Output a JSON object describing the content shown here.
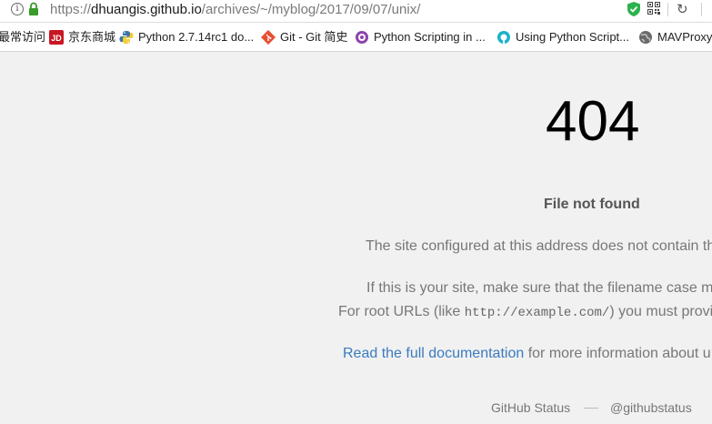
{
  "browser": {
    "url": {
      "scheme": "https://",
      "host": "dhuangis.github.io",
      "path": "/archives/~/myblog/2017/09/07/unix/"
    },
    "info_glyph": "i",
    "reload_glyph": "↻",
    "icons": {
      "info": "info-icon",
      "lock": "lock-icon",
      "shield": "shield-check-icon",
      "qr": "qr-code-icon",
      "reload": "reload-icon"
    },
    "colors": {
      "lock": "#3a9a2a",
      "shield": "#2bb24c"
    }
  },
  "bookmarks": [
    {
      "label": "最常访问",
      "icon": "none"
    },
    {
      "label": "京东商城",
      "icon": "jd-logo-icon",
      "icon_text": "JD",
      "color": "#c81623"
    },
    {
      "label": "Python 2.7.14rc1 do...",
      "icon": "python-logo-icon"
    },
    {
      "label": "Git - Git 简史",
      "icon": "git-logo-icon",
      "color": "#e84e31"
    },
    {
      "label": "Python Scripting in ...",
      "icon": "purple-gear-icon",
      "color": "#8e44ad"
    },
    {
      "label": "Using Python Script...",
      "icon": "teal-drone-icon",
      "color": "#1ab3c8"
    },
    {
      "label": "MAVProxy",
      "icon": "globe-icon",
      "color": "#555555"
    }
  ],
  "page": {
    "code": "404",
    "subtitle": "File not found",
    "line1": "The site configured at this address does not contain th",
    "line2": "If this is your site, make sure that the filename case m",
    "line3_pre": "For root URLs (like ",
    "line3_code": "http://example.com/",
    "line3_post": ") you must provid",
    "link_text": "Read the full documentation",
    "link_post": " for more information about u",
    "link_color": "#3b7bbf"
  },
  "footer": {
    "status": "GitHub Status",
    "separator": "—",
    "twitter": "@githubstatus"
  }
}
